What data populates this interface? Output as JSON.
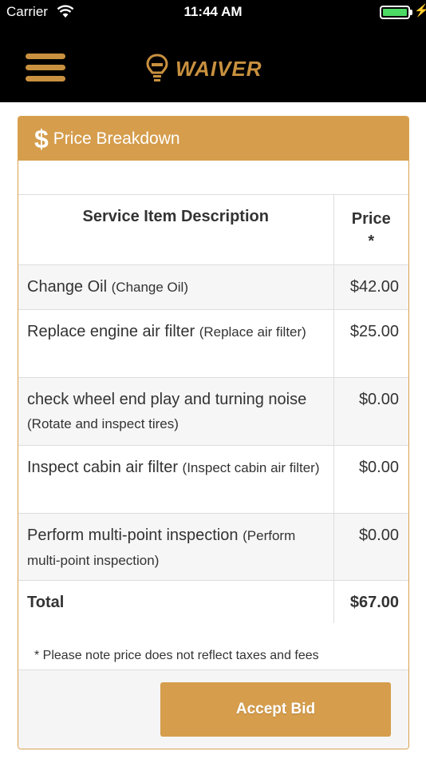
{
  "status_bar": {
    "carrier": "Carrier",
    "time": "11:44 AM",
    "battery_level": 1.0,
    "wifi_icon": "wifi-icon",
    "charging_icon": "bolt-icon"
  },
  "header": {
    "menu_icon": "hamburger-menu-icon",
    "logo_icon": "lightbulb-logo-icon",
    "logo_text": "WAIVER",
    "accent_color": "#c9913f"
  },
  "card": {
    "title_icon": "$",
    "title": "Price Breakdown",
    "header_color": "#d59d4c",
    "columns": {
      "description": "Service Item Description",
      "price": "Price",
      "price_mark": "*"
    },
    "rows": [
      {
        "name": "Change Oil",
        "detail": "(Change Oil)",
        "price": "$42.00"
      },
      {
        "name": "Replace engine air filter",
        "detail": "(Replace air filter)",
        "price": "$25.00"
      },
      {
        "name": "check wheel end play and turning noise",
        "detail": "(Rotate and inspect tires)",
        "price": "$0.00"
      },
      {
        "name": "Inspect cabin air filter",
        "detail": "(Inspect cabin air filter)",
        "price": "$0.00"
      },
      {
        "name": "Perform multi-point inspection",
        "detail": "(Perform multi-point inspection)",
        "price": "$0.00"
      }
    ],
    "total_label": "Total",
    "total_value": "$67.00",
    "note": "* Please note price does not reflect taxes and fees",
    "accept_button": "Accept Bid"
  }
}
